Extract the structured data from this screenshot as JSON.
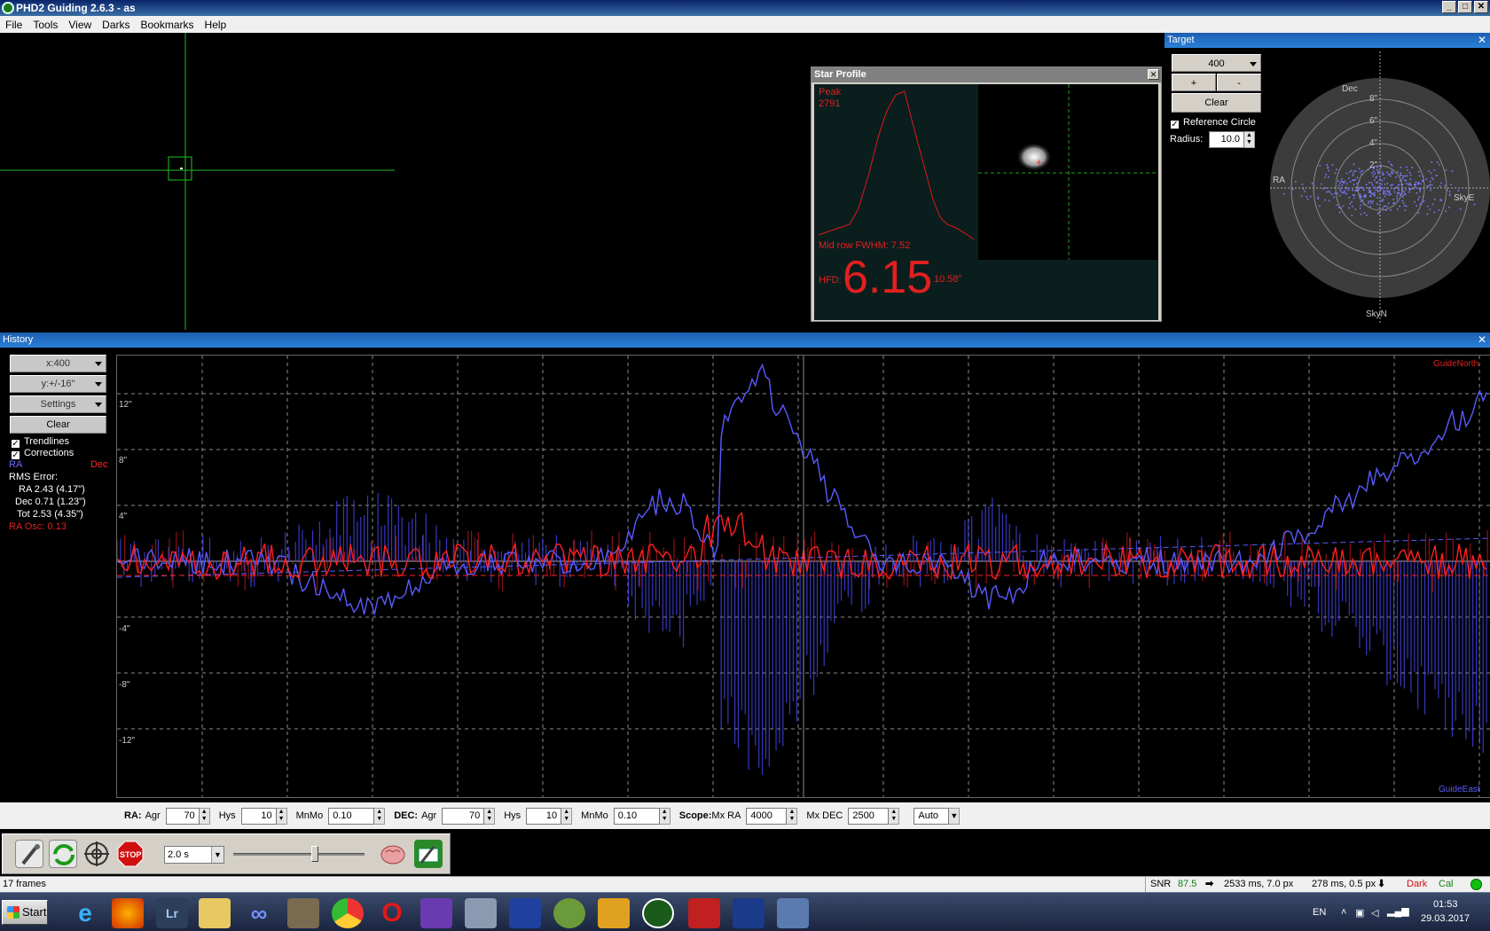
{
  "window": {
    "title": "PHD2 Guiding 2.6.3 - as",
    "minimize": "_",
    "maximize": "□",
    "close": "✕"
  },
  "menu": [
    "File",
    "Tools",
    "View",
    "Darks",
    "Bookmarks",
    "Help"
  ],
  "star_profile": {
    "title": "Star Profile",
    "peak_label": "Peak",
    "peak_value": "2791",
    "fwhm": "Mid row FWHM: 7.52",
    "hfd_label": "HFD:",
    "hfd_value": "6.15",
    "hfd_arcsec": "10.58\""
  },
  "target": {
    "title": "Target",
    "zoom_value": "400",
    "plus": "+",
    "minus": "-",
    "clear": "Clear",
    "reference_circle": "Reference Circle",
    "radius_label": "Radius:",
    "radius_value": "10.0",
    "dec_label": "Dec",
    "ra_label": "RA",
    "skye": "SkyE",
    "skyn": "SkyN",
    "ring_labels": [
      "8\"",
      "6\"",
      "4\"",
      "2\""
    ]
  },
  "history": {
    "title": "History",
    "x_scale": "x:400",
    "y_scale": "y:+/-16\"",
    "settings": "Settings",
    "clear": "Clear",
    "trendlines": "Trendlines",
    "corrections": "Corrections",
    "ra_label": "RA",
    "dec_label": "Dec",
    "rms_title": "RMS Error:",
    "rms_ra": "RA 2.43 (4.17\")",
    "rms_dec": "Dec 0.71 (1.23\")",
    "rms_tot": "Tot 2.53 (4.35\")",
    "ra_osc": "RA Osc: 0.13",
    "guide_north": "GuideNorth",
    "guide_east": "GuideEast",
    "y_ticks": [
      "12\"",
      "8\"",
      "4\"",
      "-4\"",
      "-8\"",
      "-12\""
    ]
  },
  "controls": {
    "ra_label": "RA:",
    "agr": "Agr",
    "hys": "Hys",
    "mnmo": "MnMo",
    "ra_agr": "70",
    "ra_hys": "10",
    "ra_mnmo": "0.10",
    "dec_label": "DEC:",
    "dec_agr": "70",
    "dec_hys": "10",
    "dec_mnmo": "0.10",
    "scope_label": "Scope:",
    "mx_ra": "Mx RA",
    "mx_ra_value": "4000",
    "mx_dec": "Mx DEC",
    "mx_dec_value": "2500",
    "dec_mode": "Auto"
  },
  "toolbar": {
    "exposure": "2.0 s",
    "exposure_fraction": 0.62
  },
  "status": {
    "frames": "17 frames",
    "snr_label": "SNR",
    "snr_value": "87.5",
    "ra_pulse": "2533 ms, 7.0 px",
    "dec_pulse": "278 ms, 0.5 px",
    "dark": "Dark",
    "cal": "Cal"
  },
  "taskbar": {
    "start": "Start",
    "lang": "EN",
    "time": "01:53",
    "date": "29.03.2017",
    "apps": [
      "ie-icon",
      "firefox-icon",
      "lightroom-icon",
      "explorer-icon",
      "infinity-icon",
      "gimp-icon",
      "chrome-icon",
      "opera-icon",
      "visual-studio-icon",
      "tools-icon",
      "floppy-icon",
      "android-studio-icon",
      "stack-icon",
      "phd-icon",
      "app-red-icon",
      "app-blue-icon",
      "app-window-icon"
    ],
    "lr_text": "Lr"
  },
  "colors": {
    "ra": "#5a5aff",
    "dec": "#ff2020",
    "accent": "#2a80d8"
  }
}
